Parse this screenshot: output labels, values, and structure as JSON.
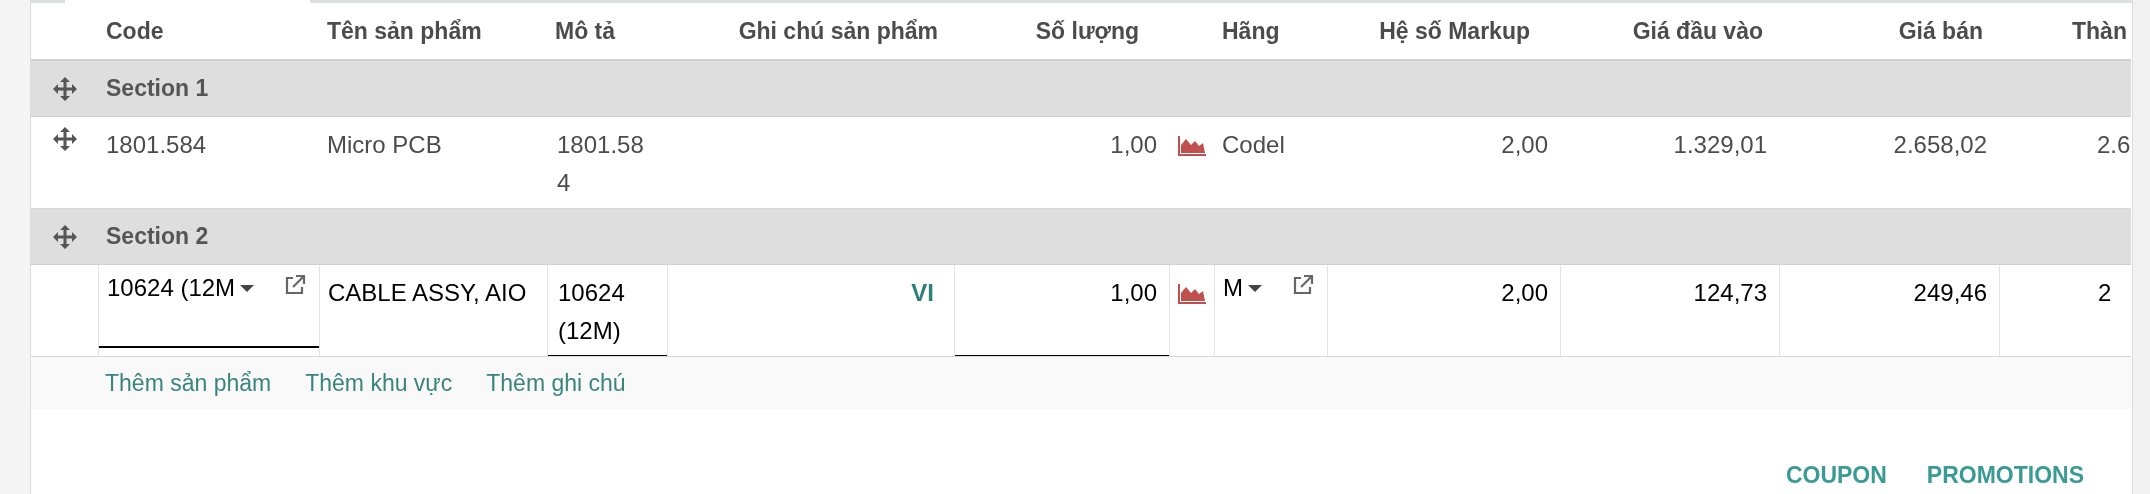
{
  "columns": [
    {
      "label": "Code"
    },
    {
      "label": "Tên sản phẩm"
    },
    {
      "label": "Mô tả"
    },
    {
      "label": "Ghi chú sản phẩm"
    },
    {
      "label": "Số lượng"
    },
    {
      "label": "Hãng"
    },
    {
      "label": "Hệ số Markup"
    },
    {
      "label": "Giá đầu vào"
    },
    {
      "label": "Giá bán"
    },
    {
      "label": "Thàn"
    }
  ],
  "rows": [
    {
      "kind": "section",
      "label": "Section 1"
    },
    {
      "kind": "product",
      "editing": false,
      "code": "1801.584",
      "name": "Micro PCB",
      "description": "1801.584",
      "quantity": "1,00",
      "brand": "Codel",
      "markup": "2,00",
      "cost": "1.329,01",
      "price": "2.658,02",
      "subtotal": "2.6"
    },
    {
      "kind": "section",
      "label": "Section 2"
    },
    {
      "kind": "product",
      "editing": true,
      "code": "10624 (12M",
      "name": "CABLE ASSY, AIO",
      "description": "10624 (12M)",
      "note": "VI",
      "quantity": "1,00",
      "brand": "M",
      "markup": "2,00",
      "cost": "124,73",
      "price": "249,46",
      "subtotal": "2"
    }
  ],
  "add_links": [
    "Thêm sản phẩm",
    "Thêm khu vực",
    "Thêm ghi chú"
  ],
  "footer_buttons": [
    "COUPON",
    "PROMOTIONS"
  ]
}
